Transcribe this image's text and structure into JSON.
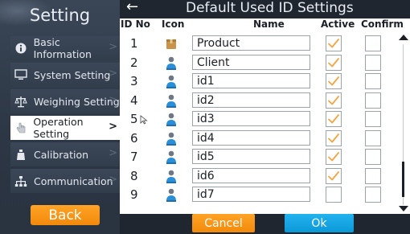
{
  "sidebar": {
    "title": "Setting",
    "items": [
      {
        "label": "Basic Information",
        "icon": "info-icon"
      },
      {
        "label": "System Setting",
        "icon": "monitor-icon"
      },
      {
        "label": "Weighing Setting",
        "icon": "scale-icon"
      },
      {
        "label": "Operation Setting",
        "icon": "hand-icon",
        "active": true
      },
      {
        "label": "Calibration",
        "icon": "weight-icon"
      },
      {
        "label": "Communication",
        "icon": "network-icon"
      }
    ],
    "back_label": "Back",
    "chevron": ">"
  },
  "header": {
    "back_arrow": "←",
    "title": "Default Used ID Settings"
  },
  "columns": {
    "id_no": "ID No",
    "icon": "Icon",
    "name": "Name",
    "active": "Active",
    "confirm": "Confirm"
  },
  "rows": [
    {
      "id": "1",
      "name": "Product",
      "icon": "product-icon",
      "active": true,
      "confirm": false
    },
    {
      "id": "2",
      "name": "Client",
      "icon": "person-icon",
      "active": true,
      "confirm": false
    },
    {
      "id": "3",
      "name": "id1",
      "icon": "person-icon",
      "active": true,
      "confirm": false
    },
    {
      "id": "4",
      "name": "id2",
      "icon": "person-icon",
      "active": true,
      "confirm": false
    },
    {
      "id": "5",
      "name": "id3",
      "icon": "person-icon",
      "active": true,
      "confirm": false
    },
    {
      "id": "6",
      "name": "id4",
      "icon": "person-icon",
      "active": true,
      "confirm": false
    },
    {
      "id": "7",
      "name": "id5",
      "icon": "person-icon",
      "active": true,
      "confirm": false
    },
    {
      "id": "8",
      "name": "id6",
      "icon": "person-icon",
      "active": true,
      "confirm": false
    },
    {
      "id": "9",
      "name": "id7",
      "icon": "person-icon",
      "active": false,
      "confirm": false
    }
  ],
  "footer": {
    "cancel_label": "Cancel",
    "ok_label": "Ok"
  },
  "colors": {
    "accent_orange": "#f7951a",
    "accent_blue": "#14a6e6",
    "check_orange": "#f5a442"
  }
}
